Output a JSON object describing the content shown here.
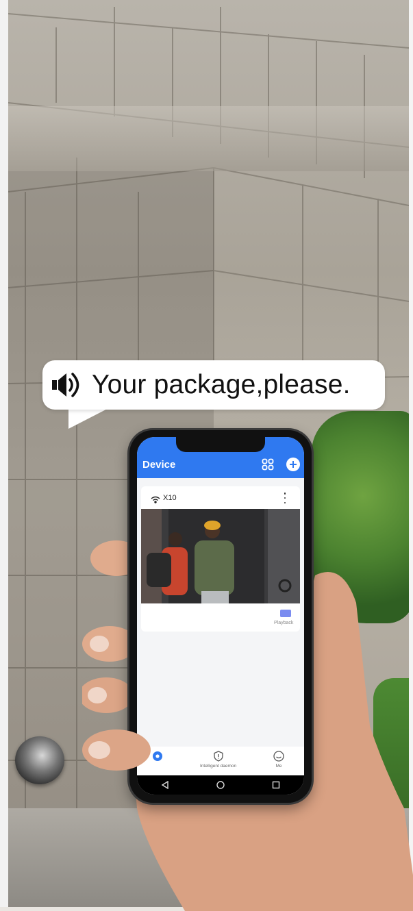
{
  "bubble": {
    "text": "Your package,please."
  },
  "app": {
    "title": "Device",
    "device": {
      "name": "X10"
    },
    "playback_label": "Playback",
    "tabs": [
      {
        "label": "",
        "icon": "camera-tab-icon",
        "active": true
      },
      {
        "label": "Intelligent daemon",
        "icon": "shield-tab-icon",
        "active": false
      },
      {
        "label": "Me",
        "icon": "profile-tab-icon",
        "active": false
      }
    ],
    "accent_color": "#2f79f0"
  }
}
